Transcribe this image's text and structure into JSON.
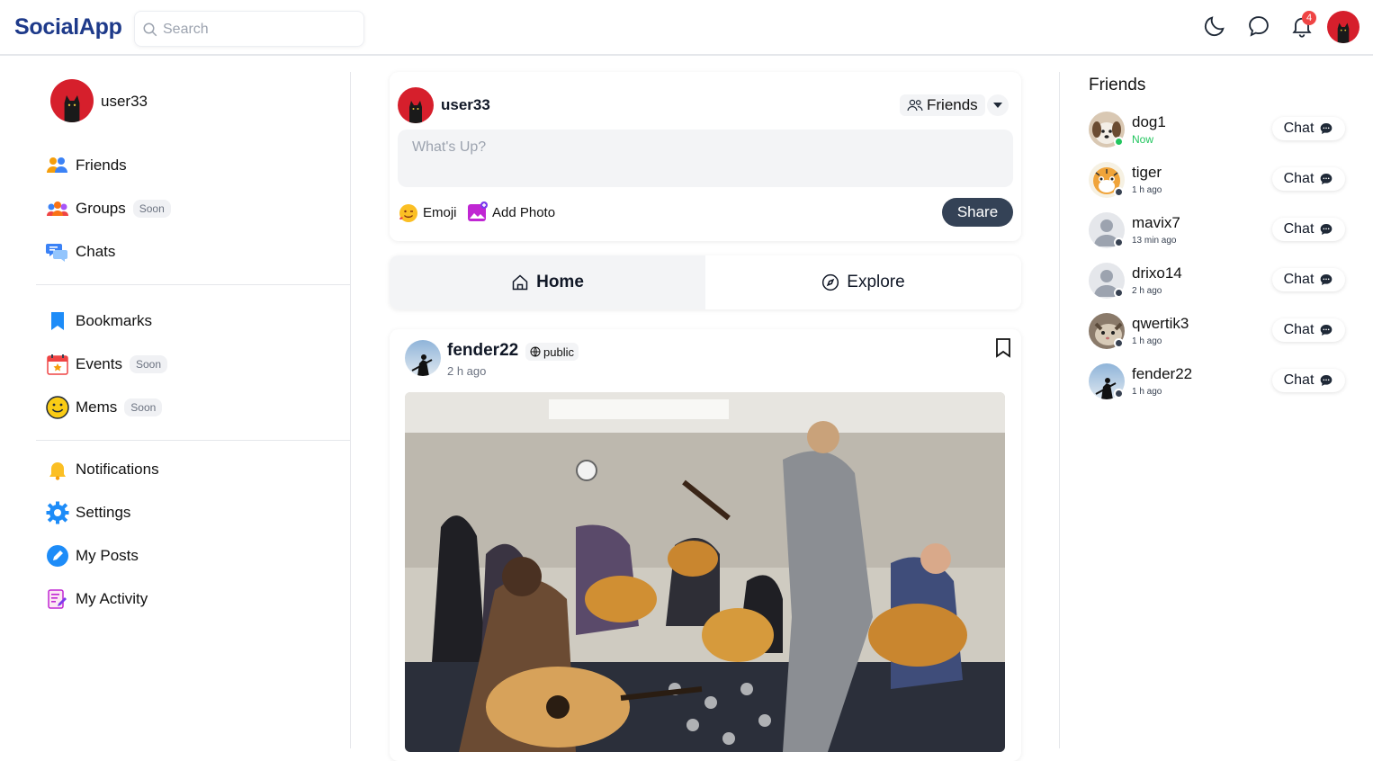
{
  "header": {
    "brand": "SocialApp",
    "search_placeholder": "Search",
    "notifications_count": "4"
  },
  "sidebar": {
    "user_name": "user33",
    "items": [
      {
        "label": "Friends",
        "soon": ""
      },
      {
        "label": "Groups",
        "soon": "Soon"
      },
      {
        "label": "Chats",
        "soon": ""
      },
      {
        "label": "Bookmarks",
        "soon": ""
      },
      {
        "label": "Events",
        "soon": "Soon"
      },
      {
        "label": "Mems",
        "soon": "Soon"
      },
      {
        "label": "Notifications",
        "soon": ""
      },
      {
        "label": "Settings",
        "soon": ""
      },
      {
        "label": "My Posts",
        "soon": ""
      },
      {
        "label": "My Activity",
        "soon": ""
      }
    ]
  },
  "composer": {
    "user_name": "user33",
    "audience": "Friends",
    "placeholder": "What's Up?",
    "emoji_label": "Emoji",
    "photo_label": "Add Photo",
    "share_label": "Share"
  },
  "tabs": [
    {
      "label": "Home",
      "active": true
    },
    {
      "label": "Explore",
      "active": false
    }
  ],
  "post": {
    "author": "fender22",
    "visibility": "public",
    "time": "2 h ago"
  },
  "friends_panel": {
    "title": "Friends",
    "chat_label": "Chat",
    "friends": [
      {
        "name": "dog1",
        "time": "Now",
        "online": true
      },
      {
        "name": "tiger",
        "time": "1 h ago",
        "online": false
      },
      {
        "name": "mavix7",
        "time": "13 min ago",
        "online": false
      },
      {
        "name": "drixo14",
        "time": "2 h ago",
        "online": false
      },
      {
        "name": "qwertik3",
        "time": "1 h ago",
        "online": false
      },
      {
        "name": "fender22",
        "time": "1 h ago",
        "online": false
      }
    ]
  },
  "colors": {
    "brand": "#1e3a8a",
    "online": "#22c55e",
    "offline": "#374151",
    "badge": "#ef4444",
    "share_button": "#344256"
  }
}
